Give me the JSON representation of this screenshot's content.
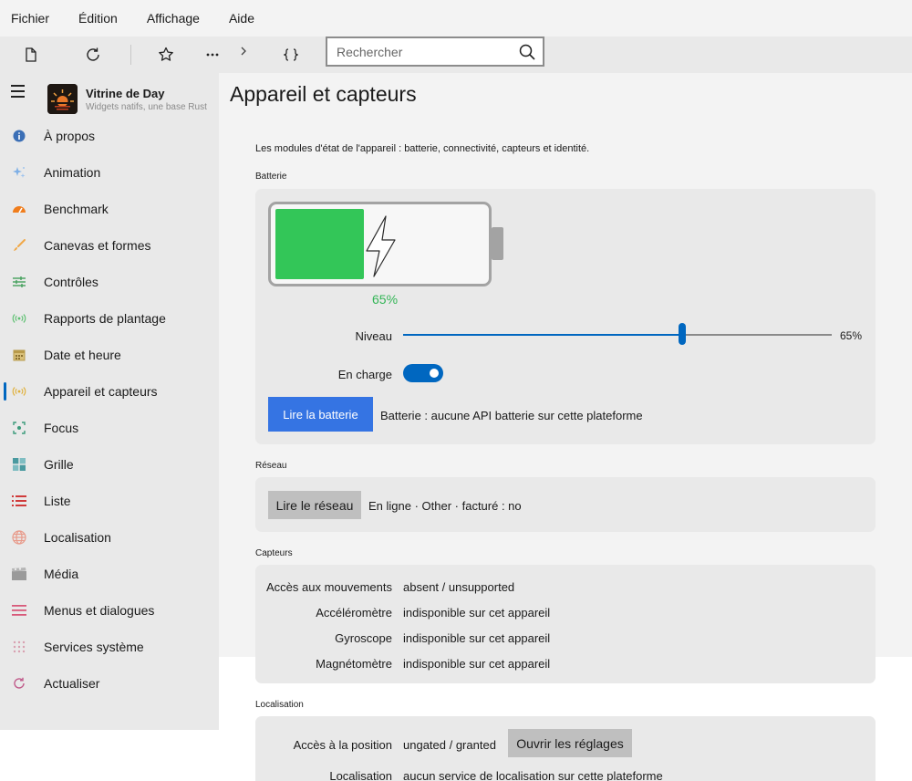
{
  "menubar": {
    "items": [
      "Fichier",
      "Édition",
      "Affichage",
      "Aide"
    ]
  },
  "toolbar": {
    "search_placeholder": "Rechercher"
  },
  "sidebar": {
    "app_title": "Vitrine de Day",
    "app_subtitle": "Widgets natifs, une base Rust",
    "items": [
      {
        "label": "À propos",
        "icon": "info-icon",
        "color": "#3b6fb6"
      },
      {
        "label": "Animation",
        "icon": "sparkles-icon",
        "color": "#7fb0e6"
      },
      {
        "label": "Benchmark",
        "icon": "speedometer-icon",
        "color": "#f07d1c"
      },
      {
        "label": "Canevas et formes",
        "icon": "brush-icon",
        "color": "#f0a848"
      },
      {
        "label": "Contrôles",
        "icon": "sliders-icon",
        "color": "#44a05c"
      },
      {
        "label": "Rapports de plantage",
        "icon": "broadcast-icon",
        "color": "#5cc070"
      },
      {
        "label": "Date et heure",
        "icon": "calendar-icon",
        "color": "#b89a4a"
      },
      {
        "label": "Appareil et capteurs",
        "icon": "sensor-icon",
        "color": "#e0b03a",
        "active": true
      },
      {
        "label": "Focus",
        "icon": "focus-icon",
        "color": "#3a9a7a"
      },
      {
        "label": "Grille",
        "icon": "grid-icon",
        "color": "#4a9aa0"
      },
      {
        "label": "Liste",
        "icon": "list-icon",
        "color": "#d03b3b"
      },
      {
        "label": "Localisation",
        "icon": "globe-icon",
        "color": "#e89a8a"
      },
      {
        "label": "Média",
        "icon": "film-icon",
        "color": "#9a9a9a"
      },
      {
        "label": "Menus et dialogues",
        "icon": "menu-icon",
        "color": "#d85a7a"
      },
      {
        "label": "Services système",
        "icon": "dots-grid-icon",
        "color": "#d8a0b0"
      },
      {
        "label": "Actualiser",
        "icon": "refresh-icon",
        "color": "#c05a8a"
      }
    ]
  },
  "main": {
    "title": "Appareil et capteurs",
    "intro": "Les modules d'état de l'appareil : batterie, connectivité, capteurs et identité.",
    "battery": {
      "heading": "Batterie",
      "percent_label": "65%",
      "level": 0.65,
      "level_label": "Niveau",
      "level_value": "65%",
      "charging_label": "En charge",
      "charging": true,
      "read_button": "Lire la batterie",
      "status": "Batterie : aucune API batterie sur cette plateforme",
      "fill_color": "#33c658"
    },
    "network": {
      "heading": "Réseau",
      "read_button": "Lire le réseau",
      "status": "En ligne · Other · facturé : no"
    },
    "sensors": {
      "heading": "Capteurs",
      "rows": [
        {
          "label": "Accès aux mouvements",
          "value": "absent / unsupported"
        },
        {
          "label": "Accéléromètre",
          "value": "indisponible sur cet appareil"
        },
        {
          "label": "Gyroscope",
          "value": "indisponible sur cet appareil"
        },
        {
          "label": "Magnétomètre",
          "value": "indisponible sur cet appareil"
        }
      ]
    },
    "location": {
      "heading": "Localisation",
      "access_label": "Accès à la position",
      "access_value": "ungated / granted",
      "settings_button": "Ouvrir les réglages",
      "location_label": "Localisation",
      "location_value": "aucun service de localisation sur cette plateforme"
    }
  },
  "colors": {
    "accent": "#0067c0",
    "button_accent": "#3574e3",
    "battery_green": "#33c658"
  }
}
